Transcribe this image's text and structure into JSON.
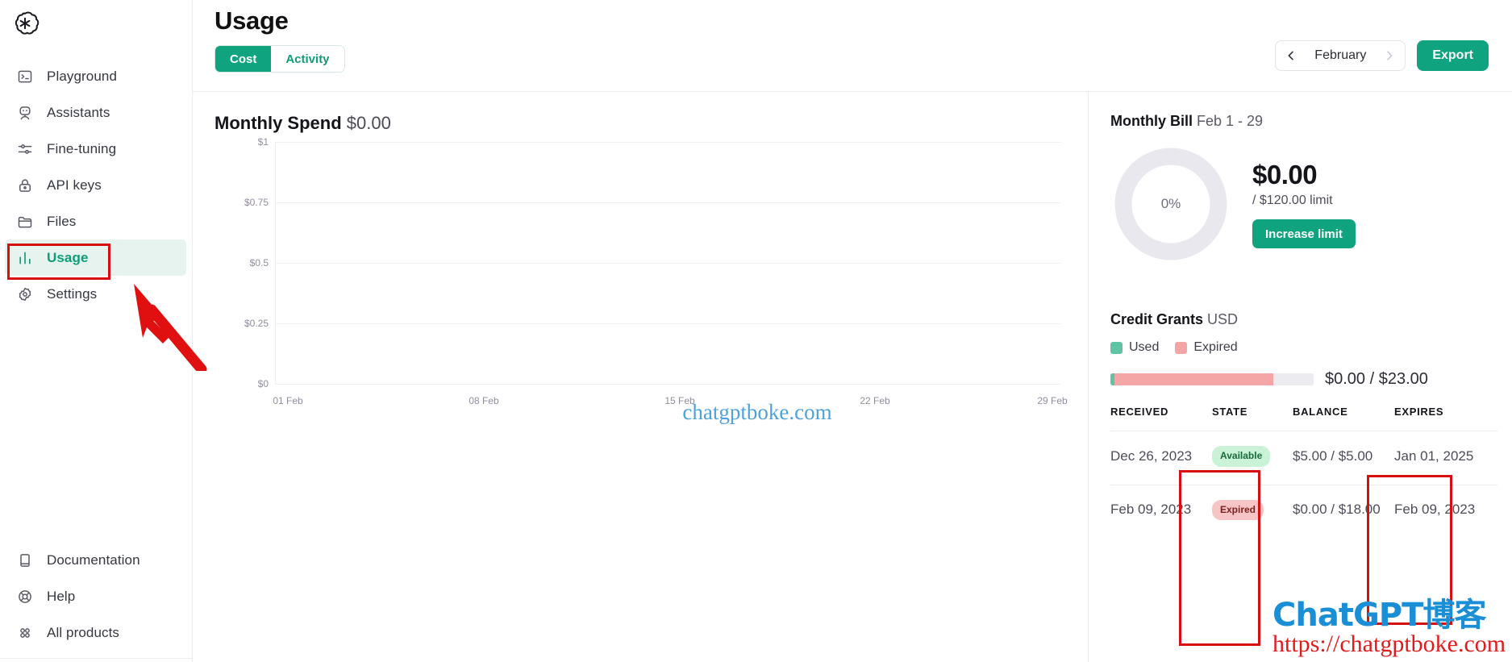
{
  "sidebar": {
    "logo_icon": "openai-logo",
    "top_items": [
      {
        "label": "Playground",
        "icon": "terminal-icon",
        "active": false
      },
      {
        "label": "Assistants",
        "icon": "robot-icon",
        "active": false
      },
      {
        "label": "Fine-tuning",
        "icon": "sliders-icon",
        "active": false
      },
      {
        "label": "API keys",
        "icon": "lock-icon",
        "active": false
      },
      {
        "label": "Files",
        "icon": "folder-icon",
        "active": false
      },
      {
        "label": "Usage",
        "icon": "bar-chart-icon",
        "active": true
      },
      {
        "label": "Settings",
        "icon": "gear-icon",
        "active": false
      }
    ],
    "bottom_items": [
      {
        "label": "Documentation",
        "icon": "book-icon"
      },
      {
        "label": "Help",
        "icon": "lifebuoy-icon"
      },
      {
        "label": "All products",
        "icon": "grid-icon"
      }
    ]
  },
  "header": {
    "title": "Usage",
    "tabs": [
      {
        "label": "Cost",
        "active": true
      },
      {
        "label": "Activity",
        "active": false
      }
    ],
    "month": "February",
    "prev_icon": "chevron-left-icon",
    "next_icon": "chevron-right-icon",
    "export_label": "Export"
  },
  "chart_data": {
    "type": "line",
    "title": "Monthly Spend",
    "title_value": "$0.00",
    "xlabel": "",
    "ylabel": "",
    "ylim": [
      0,
      1
    ],
    "yticks": [
      "$0",
      "$0.25",
      "$0.5",
      "$0.75",
      "$1"
    ],
    "ytick_values": [
      0,
      0.25,
      0.5,
      0.75,
      1
    ],
    "xticks": [
      "01 Feb",
      "08 Feb",
      "15 Feb",
      "22 Feb",
      "29 Feb"
    ],
    "x": [
      "01 Feb",
      "08 Feb",
      "15 Feb",
      "22 Feb",
      "29 Feb"
    ],
    "values": [
      0,
      0,
      0,
      0,
      0
    ],
    "grid": true,
    "legend": "none",
    "watermark": "chatgptboke.com"
  },
  "bill": {
    "heading": "Monthly Bill",
    "range": "Feb 1 - 29",
    "percent_label": "0%",
    "percent_value": 0,
    "amount": "$0.00",
    "limit": "/ $120.00 limit",
    "increase_label": "Increase limit"
  },
  "credits": {
    "heading": "Credit Grants",
    "currency": "USD",
    "legend": [
      {
        "label": "Used",
        "color": "#5ec4a4"
      },
      {
        "label": "Expired",
        "color": "#f4a6a6"
      }
    ],
    "bar": {
      "used_pct": 2,
      "expired_pct": 78,
      "track_color": "#ebebf0"
    },
    "bar_label": "$0.00 / $23.00",
    "columns": [
      "RECEIVED",
      "STATE",
      "BALANCE",
      "EXPIRES"
    ],
    "rows": [
      {
        "received": "Dec 26, 2023",
        "state": "Available",
        "state_kind": "available",
        "balance": "$5.00 / $5.00",
        "expires": "Jan 01, 2025"
      },
      {
        "received": "Feb 09, 2023",
        "state": "Expired",
        "state_kind": "expired",
        "balance": "$0.00 / $18.00",
        "expires": "Feb 09, 2023"
      }
    ]
  },
  "annotations": {
    "color": "#d80f0f",
    "arrow_icon": "arrow-pointer",
    "watermark_logo": "ChatGPT博客",
    "watermark_url": "https://chatgptboke.com"
  }
}
